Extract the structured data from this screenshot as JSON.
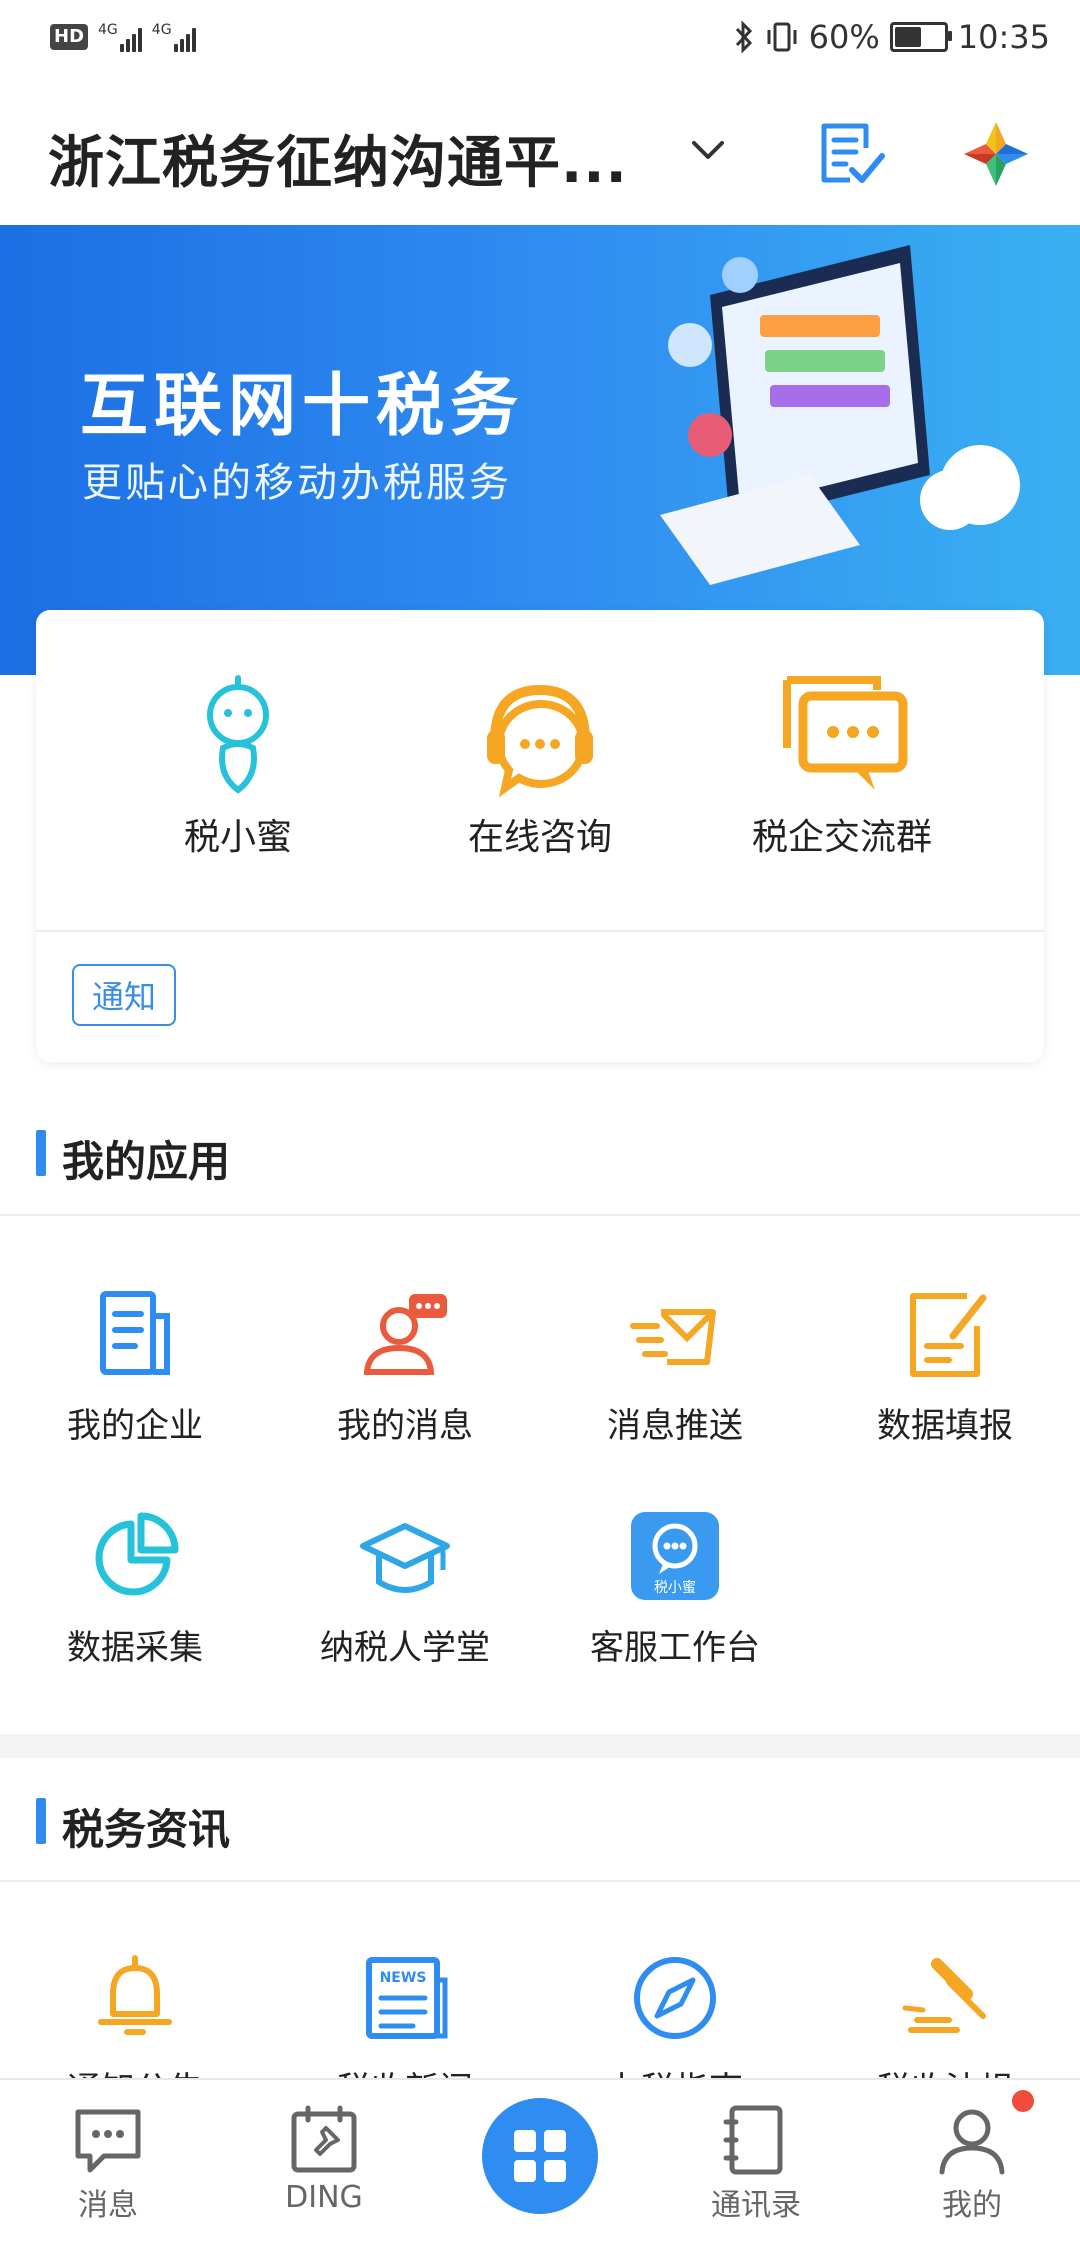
{
  "status_bar": {
    "hd": "HD",
    "net1": "4G",
    "net2": "4G",
    "battery": "60%",
    "battery_level": 0.6,
    "time": "10:35"
  },
  "header": {
    "title": "浙江税务征纳沟通平...",
    "icons": [
      "chevron-down-icon",
      "todo-check-icon",
      "app-logo-icon"
    ]
  },
  "banner": {
    "headline": "互联网十税务",
    "subline": "更贴心的移动办税服务"
  },
  "quick_actions": [
    {
      "label": "税小蜜",
      "icon": "robot-icon"
    },
    {
      "label": "在线咨询",
      "icon": "headset-chat-icon"
    },
    {
      "label": "税企交流群",
      "icon": "chat-bubble-icon"
    }
  ],
  "notice": {
    "label": "通知"
  },
  "my_apps": {
    "title": "我的应用",
    "items": [
      {
        "label": "我的企业",
        "icon": "document-icon"
      },
      {
        "label": "我的消息",
        "icon": "user-message-icon"
      },
      {
        "label": "消息推送",
        "icon": "send-mail-icon"
      },
      {
        "label": "数据填报",
        "icon": "edit-form-icon"
      },
      {
        "label": "数据采集",
        "icon": "pie-chart-icon"
      },
      {
        "label": "纳税人学堂",
        "icon": "graduation-cap-icon"
      },
      {
        "label": "客服工作台",
        "icon": "service-bot-icon",
        "badge": "税小蜜"
      }
    ]
  },
  "tax_news": {
    "title": "税务资讯",
    "items": [
      {
        "label": "通知公告",
        "icon": "bell-icon"
      },
      {
        "label": "税收新闻",
        "icon": "news-icon",
        "badge": "NEWS"
      },
      {
        "label": "办税指南",
        "icon": "compass-icon"
      },
      {
        "label": "税收法规",
        "icon": "gavel-icon"
      }
    ]
  },
  "bottom_nav": [
    {
      "label": "消息",
      "icon": "message-icon"
    },
    {
      "label": "DING",
      "icon": "ding-icon"
    },
    {
      "label": "",
      "icon": "workbench-grid-icon"
    },
    {
      "label": "通讯录",
      "icon": "contacts-icon"
    },
    {
      "label": "我的",
      "icon": "profile-icon"
    }
  ],
  "colors": {
    "accent": "#2f8cf0",
    "orange": "#f5a623",
    "red": "#ea5a3c",
    "cyan": "#25c2d9"
  }
}
